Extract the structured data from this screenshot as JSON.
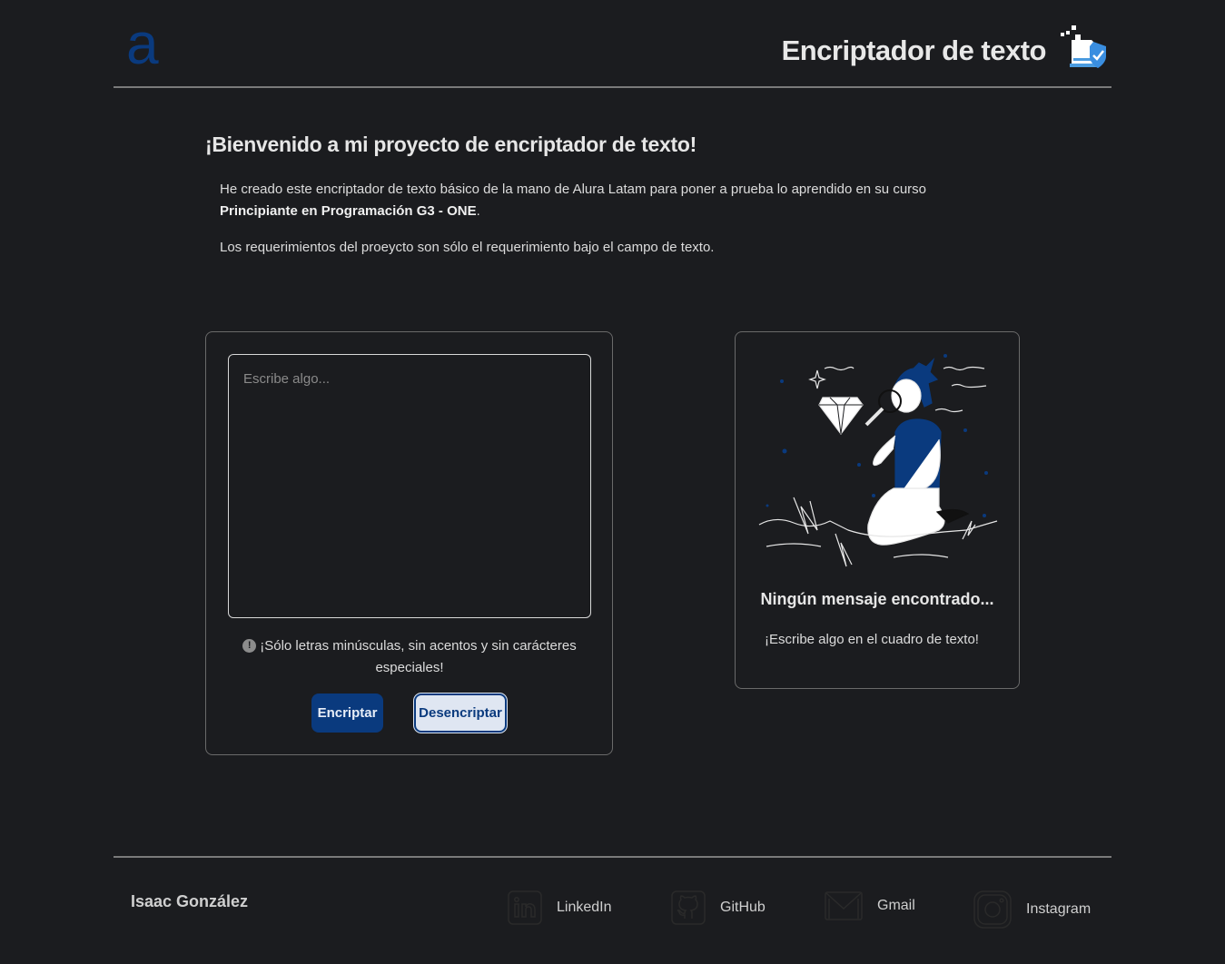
{
  "header": {
    "logo_text": "a",
    "title": "Encriptador de texto"
  },
  "intro": {
    "heading": "¡Bienvenido a mi proyecto de encriptador de texto!",
    "p1_text": "He creado este encriptador de texto básico de la mano de Alura Latam para poner a prueba lo aprendido en su curso ",
    "p1_bold": "Principiante en Programación G3 - ONE",
    "p1_end": ".",
    "p2": "Los requerimientos del proeycto son sólo el requerimiento bajo el campo de texto."
  },
  "input": {
    "placeholder": "Escribe algo...",
    "value": "",
    "note_icon": "!",
    "note": "¡Sólo letras minúsculas, sin acentos y sin carácteres especiales!",
    "encrypt_label": "Encriptar",
    "decrypt_label": "Desencriptar"
  },
  "output": {
    "title": "Ningún mensaje encontrado...",
    "subtitle": "¡Escribe algo en el cuadro de texto!"
  },
  "footer": {
    "author": "Isaac González",
    "links": [
      {
        "label": "LinkedIn",
        "icon": "linkedin-icon"
      },
      {
        "label": "GitHub",
        "icon": "github-icon"
      },
      {
        "label": "Gmail",
        "icon": "gmail-icon"
      },
      {
        "label": "Instagram",
        "icon": "instagram-icon"
      }
    ]
  },
  "colors": {
    "background": "#1b1c1f",
    "accent": "#0a3a7e",
    "button_light": "#dfe6f2",
    "text": "#e6e6e6",
    "divider": "#7a7a7a"
  }
}
